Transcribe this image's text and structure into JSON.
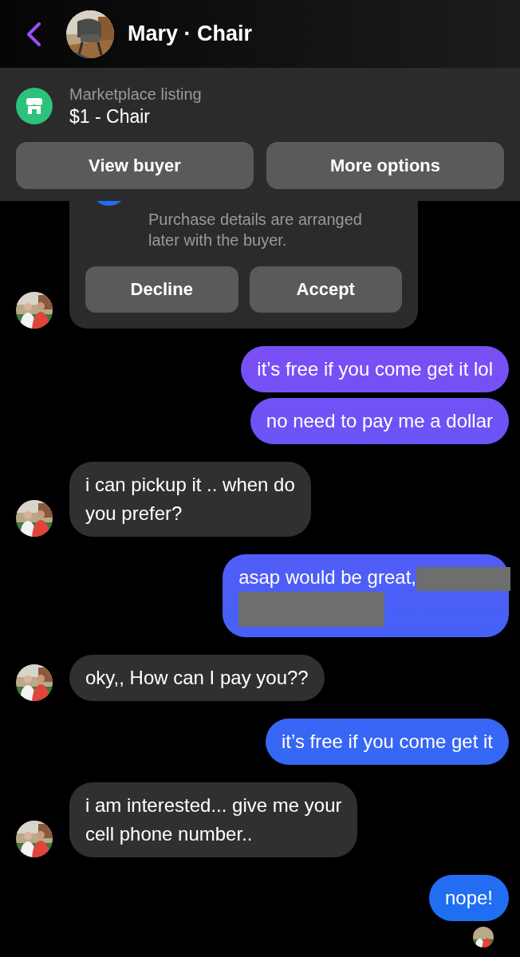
{
  "header": {
    "title": "Mary · Chair"
  },
  "listing": {
    "label": "Marketplace listing",
    "title": "$1 - Chair",
    "buttons": [
      "View buyer",
      "More options"
    ]
  },
  "offer_card": {
    "text": "Purchase details are arranged later with the buyer.",
    "buttons": [
      "Decline",
      "Accept"
    ]
  },
  "messages": [
    {
      "kind": "outgoing",
      "text": "it’s free if you come get it lol",
      "redacted": false,
      "seen": false
    },
    {
      "kind": "outgoing",
      "text": "no need to pay me a dollar",
      "redacted": false,
      "seen": false
    },
    {
      "kind": "incoming",
      "text": "i can pickup it .. when do\nyou prefer?",
      "redacted": false,
      "seen": false
    },
    {
      "kind": "outgoing",
      "text": "asap would be great,",
      "redacted": true,
      "seen": false
    },
    {
      "kind": "incoming",
      "text": "oky,,  How can I pay you??",
      "redacted": false,
      "seen": false
    },
    {
      "kind": "outgoing",
      "text": "it’s free if you come get it",
      "redacted": false,
      "seen": false
    },
    {
      "kind": "incoming",
      "text": "i am interested... give me your\ncell phone number..",
      "redacted": false,
      "seen": false
    },
    {
      "kind": "outgoing",
      "text": "nope!",
      "redacted": false,
      "seen": true
    }
  ]
}
